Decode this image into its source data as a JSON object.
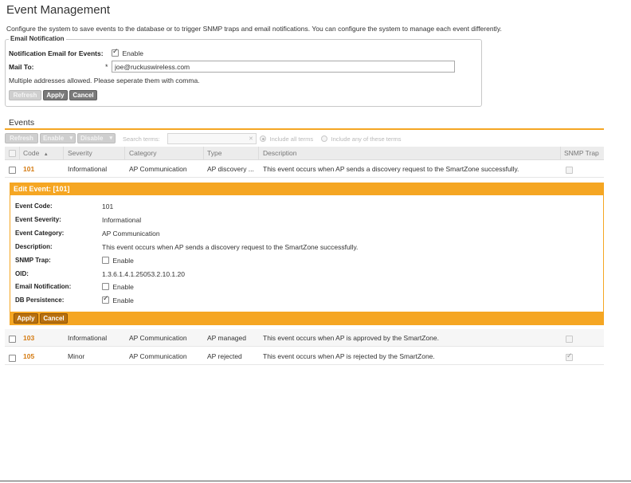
{
  "page": {
    "title": "Event Management",
    "intro": "Configure the system to save events to the database or to trigger SNMP traps and email notifications. You can configure the system to manage each event differently."
  },
  "email_notification": {
    "legend": "Email Notification",
    "notify_label": "Notification Email for Events:",
    "enable_checked": true,
    "enable_label": "Enable",
    "mail_to_label": "Mail To:",
    "required_mark": "*",
    "mail_to_value": "joe@ruckuswireless.com",
    "hint": "Multiple addresses allowed. Please seperate them with comma.",
    "refresh_label": "Refresh",
    "apply_label": "Apply",
    "cancel_label": "Cancel"
  },
  "events": {
    "section_title": "Events",
    "toolbar": {
      "refresh_label": "Refresh",
      "enable_label": "Enable",
      "disable_label": "Disable",
      "dropdown_glyph": "▾",
      "search_label": "Search terms:",
      "search_value": "",
      "clear_glyph": "✕",
      "include_all_label": "Include all terms",
      "include_any_label": "Include any of these terms",
      "include_all_selected": true
    },
    "columns": {
      "code": "Code",
      "sort_glyph": "▲",
      "severity": "Severity",
      "category": "Category",
      "type": "Type",
      "description": "Description",
      "snmp_trap": "SNMP Trap"
    },
    "rows": [
      {
        "code": "101",
        "severity": "Informational",
        "category": "AP Communication",
        "type": "AP discovery ...",
        "description": "This event occurs when AP sends a discovery request to the SmartZone successfully.",
        "snmp_trap": false
      },
      {
        "code": "103",
        "severity": "Informational",
        "category": "AP Communication",
        "type": "AP managed",
        "description": "This event occurs when AP is approved by the SmartZone.",
        "snmp_trap": false
      },
      {
        "code": "105",
        "severity": "Minor",
        "category": "AP Communication",
        "type": "AP rejected",
        "description": "This event occurs when AP is rejected by the SmartZone.",
        "snmp_trap": true
      }
    ],
    "edit": {
      "title": "Edit Event: [101]",
      "code_label": "Event Code:",
      "code_value": "101",
      "severity_label": "Event Severity:",
      "severity_value": "Informational",
      "category_label": "Event Category:",
      "category_value": "AP Communication",
      "description_label": "Description:",
      "description_value": "This event occurs when AP sends a discovery request to the SmartZone successfully.",
      "snmp_label": "SNMP Trap:",
      "snmp_enable_label": "Enable",
      "snmp_checked": false,
      "oid_label": "OID:",
      "oid_value": "1.3.6.1.4.1.25053.2.10.1.20",
      "email_label": "Email Notification:",
      "email_enable_label": "Enable",
      "email_checked": false,
      "db_label": "DB Persistence:",
      "db_enable_label": "Enable",
      "db_checked": true,
      "apply_label": "Apply",
      "cancel_label": "Cancel"
    }
  },
  "colors": {
    "accent": "#f5a623",
    "code_text": "#d47a10",
    "button_gray": "#7a7a7a",
    "button_orange": "#b8700f"
  }
}
